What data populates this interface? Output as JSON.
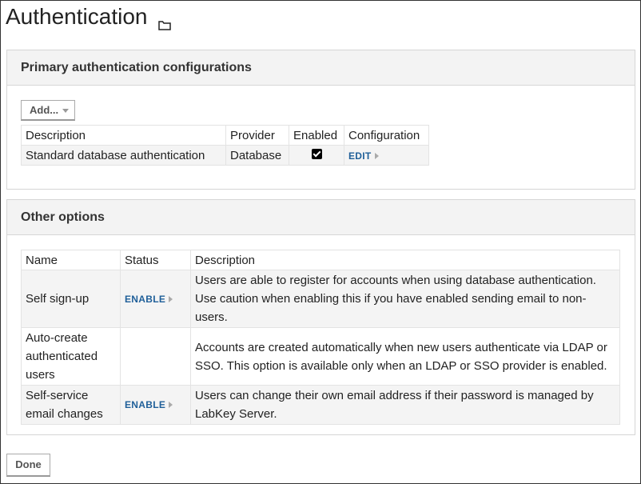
{
  "page": {
    "title": "Authentication",
    "icon": "folder-icon"
  },
  "primary": {
    "heading": "Primary authentication configurations",
    "add_label": "Add...",
    "columns": [
      "Description",
      "Provider",
      "Enabled",
      "Configuration"
    ],
    "rows": [
      {
        "description": "Standard database authentication",
        "provider": "Database",
        "enabled": true,
        "configuration": "EDIT"
      }
    ]
  },
  "other": {
    "heading": "Other options",
    "columns": [
      "Name",
      "Status",
      "Description"
    ],
    "rows": [
      {
        "name": "Self sign-up",
        "status": "ENABLE",
        "description": "Users are able to register for accounts when using database authentication. Use caution when enabling this if you have enabled sending email to non-users."
      },
      {
        "name": "Auto-create authenticated users",
        "status": "",
        "description": "Accounts are created automatically when new users authenticate via LDAP or SSO. This option is available only when an LDAP or SSO provider is enabled."
      },
      {
        "name": "Self-service email changes",
        "status": "ENABLE",
        "description": "Users can change their own email address if their password is managed by LabKey Server."
      }
    ]
  },
  "footer": {
    "done_label": "Done"
  },
  "colors": {
    "link": "#1f5f99",
    "panel_header_bg": "#f3f3f3"
  }
}
